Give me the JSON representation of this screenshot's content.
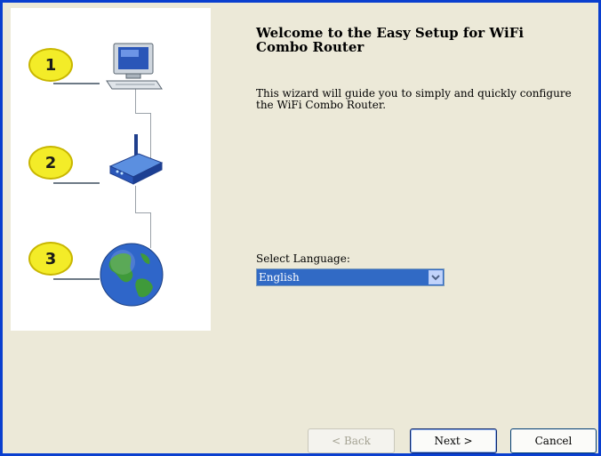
{
  "wizard": {
    "title": "Welcome to the Easy Setup for WiFi Combo Router",
    "intro": "This wizard will guide you to simply and quickly configure the WiFi Combo Router."
  },
  "steps": [
    {
      "number": "1",
      "icon": "computer-icon"
    },
    {
      "number": "2",
      "icon": "router-icon"
    },
    {
      "number": "3",
      "icon": "globe-icon"
    }
  ],
  "language": {
    "label": "Select Language:",
    "selected": "English"
  },
  "buttons": {
    "back": "< Back",
    "next": "Next >",
    "cancel": "Cancel"
  },
  "colors": {
    "window_border": "#0a3fcf",
    "panel_background": "#ece9d8",
    "badge_yellow": "#f3ec28",
    "selection_blue": "#316ac5"
  }
}
